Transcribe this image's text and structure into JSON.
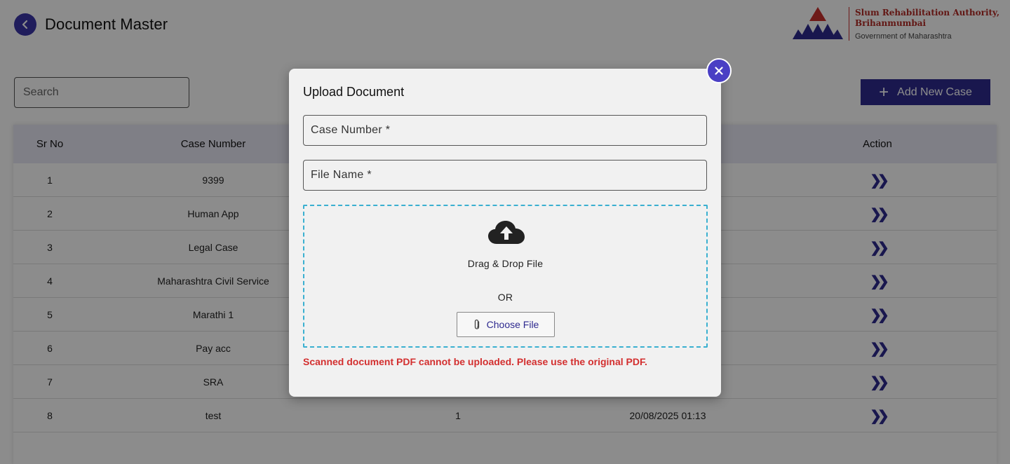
{
  "header": {
    "title": "Document Master",
    "logo": {
      "line1": "Slum Rehabilitation Authority,",
      "line2": "Brihanmumbai",
      "line3": "Government of Maharashtra"
    }
  },
  "toolbar": {
    "search_placeholder": "Search",
    "add_label": "Add New Case"
  },
  "table": {
    "columns": [
      "Sr No",
      "Case Number",
      "Action"
    ],
    "rows": [
      {
        "sr": "1",
        "case": "9399",
        "count": "",
        "date": ""
      },
      {
        "sr": "2",
        "case": "Human App",
        "count": "",
        "date": ""
      },
      {
        "sr": "3",
        "case": "Legal Case",
        "count": "",
        "date": ""
      },
      {
        "sr": "4",
        "case": "Maharashtra Civil Service",
        "count": "",
        "date": ""
      },
      {
        "sr": "5",
        "case": "Marathi 1",
        "count": "",
        "date": ""
      },
      {
        "sr": "6",
        "case": "Pay acc",
        "count": "",
        "date": ""
      },
      {
        "sr": "7",
        "case": "SRA",
        "count": "",
        "date": ""
      },
      {
        "sr": "8",
        "case": "test",
        "count": "1",
        "date": "20/08/2025 01:13"
      }
    ]
  },
  "modal": {
    "title": "Upload Document",
    "case_number_placeholder": "Case Number *",
    "file_name_placeholder": "File Name *",
    "drag_text": "Drag & Drop File",
    "or_text": "OR",
    "choose_label": "Choose File",
    "error": "Scanned document PDF cannot be uploaded. Please use the original PDF."
  },
  "colors": {
    "primary": "#2e2a8f",
    "close": "#4a3fc4",
    "error": "#d32f2f",
    "dropzone_border": "#3ab0d0"
  }
}
